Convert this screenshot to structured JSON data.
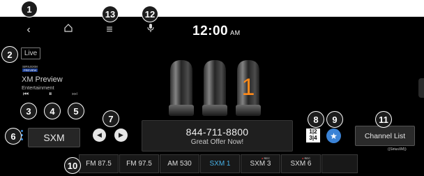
{
  "callouts": [
    "1",
    "2",
    "3",
    "4",
    "5",
    "6",
    "7",
    "8",
    "9",
    "10",
    "11",
    "12",
    "13"
  ],
  "header": {
    "icons": {
      "back": "back-arrow-icon",
      "home": "home-icon",
      "menu": "menu-icon",
      "mic": "microphone-icon"
    },
    "time": "12:00",
    "ampm": "AM"
  },
  "source": {
    "live": "Live",
    "brand": "SIRIUSXM",
    "badge": "PREVIEW",
    "channel_name": "XM Preview",
    "category": "Entertainment"
  },
  "playback": {
    "prev": "⏮",
    "pause": "⏸",
    "next": "⏭"
  },
  "band": {
    "label": "SXM"
  },
  "tuner": {
    "display_digit": "1"
  },
  "info": {
    "phone": "844-711-8800",
    "text": "Great Offer Now!"
  },
  "grid": {
    "label": "1|2 3|4"
  },
  "channel_list": {
    "label": "Channel List"
  },
  "logo_small": "((SiriusXM))",
  "presets": [
    {
      "label": "FM 87.5",
      "rec": ""
    },
    {
      "label": "FM 97.5",
      "rec": ""
    },
    {
      "label": "AM 530",
      "rec": ""
    },
    {
      "label": "SXM 1",
      "rec": ""
    },
    {
      "label": "SXM 3",
      "rec": "REC"
    },
    {
      "label": "SXM 6",
      "rec": "REC"
    },
    {
      "label": "",
      "rec": ""
    }
  ],
  "colors": {
    "accent": "#3b83d6",
    "active_preset": "#47b2e8",
    "tube_glow": "#ff8a1a"
  }
}
